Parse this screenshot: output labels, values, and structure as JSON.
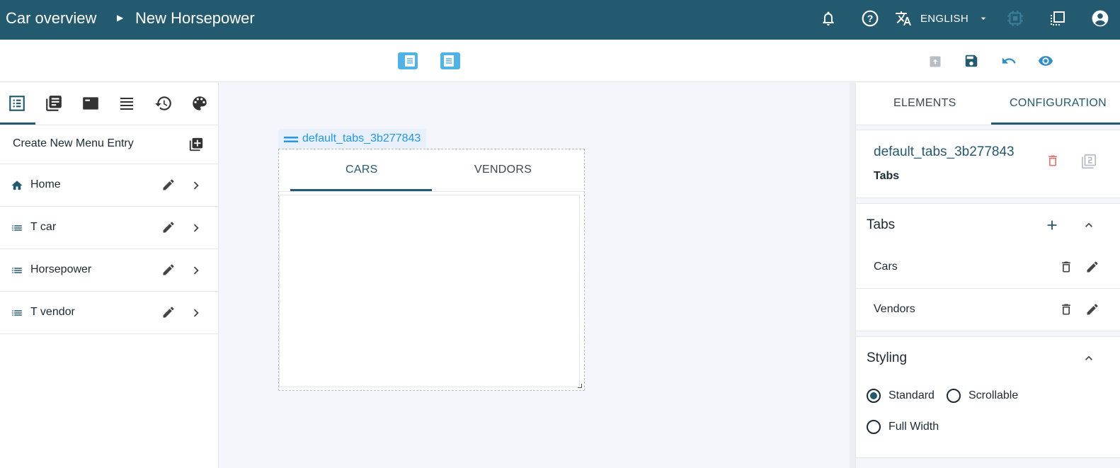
{
  "header": {
    "breadcrumb": [
      "Car overview",
      "New Horsepower"
    ],
    "language": "ENGLISH",
    "icons": [
      "bell-icon",
      "help-icon",
      "translate-icon",
      "dropdown-icon",
      "chip-icon",
      "window-icon",
      "account-icon"
    ]
  },
  "toolbar": {
    "view_icons": [
      "layout-left-icon",
      "layout-full-icon"
    ],
    "action_icons": [
      "publish-icon",
      "save-icon",
      "undo-icon",
      "preview-icon"
    ]
  },
  "sidebar": {
    "tab_icons": [
      "list-icon",
      "library-icon",
      "card-icon",
      "rows-icon",
      "history-icon",
      "palette-icon"
    ],
    "create_label": "Create New Menu Entry",
    "items": [
      {
        "label": "Home",
        "icon": "home-icon"
      },
      {
        "label": "T car",
        "icon": "list-icon"
      },
      {
        "label": "Horsepower",
        "icon": "list-icon"
      },
      {
        "label": "T vendor",
        "icon": "list-icon"
      }
    ]
  },
  "canvas": {
    "component_tag": "default_tabs_3b277843",
    "tabs": [
      "CARS",
      "VENDORS"
    ],
    "active_tab": 0
  },
  "panel": {
    "tabs": [
      "ELEMENTS",
      "CONFIGURATION"
    ],
    "active_tab": 1,
    "component_id": "default_tabs_3b277843",
    "component_type": "Tabs",
    "tabs_section": {
      "title": "Tabs",
      "items": [
        "Cars",
        "Vendors"
      ]
    },
    "styling_section": {
      "title": "Styling",
      "options": [
        "Standard",
        "Scrollable",
        "Full Width"
      ],
      "selected": "Standard"
    }
  },
  "colors": {
    "header_bg": "#245a70",
    "accent_blue": "#2196f3",
    "delete_red": "#e57373"
  }
}
